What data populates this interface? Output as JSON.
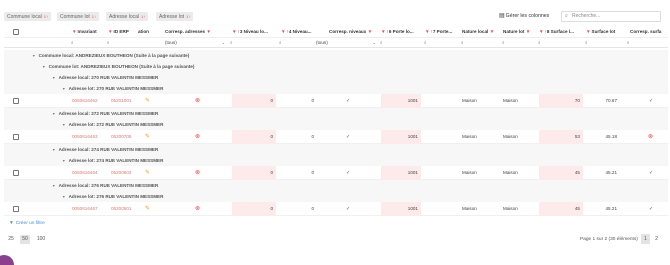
{
  "toolbar": {
    "chips": [
      {
        "label": "Commune local",
        "sort": "1↑"
      },
      {
        "label": "Commune lot",
        "sort": "1↑"
      },
      {
        "label": "Adresse local",
        "sort": "1↑"
      },
      {
        "label": "Adresse lot",
        "sort": "1↑"
      }
    ],
    "manage_columns": "Gérer les colonnes",
    "search_placeholder": "Recherche..."
  },
  "columns": [
    {
      "key": "invariant",
      "label": "Invariant"
    },
    {
      "key": "id_erp",
      "label": "ID ERP"
    },
    {
      "key": "action",
      "label": "ation"
    },
    {
      "key": "corresp_adresses",
      "label": "Corresp. adresses"
    },
    {
      "key": "niveau_lo",
      "label": "↑3 Niveau lo..."
    },
    {
      "key": "niveau",
      "label": "↑4 Niveau..."
    },
    {
      "key": "corresp_niveaux",
      "label": "Corresp. niveaux"
    },
    {
      "key": "porte_lo",
      "label": "↑6 Porte lo..."
    },
    {
      "key": "porte",
      "label": "↑7 Porte..."
    },
    {
      "key": "nature_local",
      "label": "Nature local"
    },
    {
      "key": "nature_lot",
      "label": "Nature lot"
    },
    {
      "key": "surface_l",
      "label": "↑8 Surface l..."
    },
    {
      "key": "surface_lot",
      "label": "Surface lot"
    },
    {
      "key": "corresp_surf",
      "label": "Corresp. surfa"
    }
  ],
  "filters": {
    "corresp_adresses": "(tous)",
    "corresp_niveaux": "(tous)"
  },
  "groups": {
    "commune_local": "Commune local: ANDREZIEUX BOUTHEON (Suite à la page suivante)",
    "commune_lot": "Commune lot: ANDREZIEUX BOUTHEON (Suite à la page suivante)"
  },
  "records": [
    {
      "adresse_local": "Adresse local: 270 RUE VALENTIN MESSMER",
      "adresse_lot": "Adresse lot: 270 RUE VALENTIN MESSMER",
      "invariant": "0050616462",
      "id_erp": "05201001",
      "niveau_lo": "0",
      "niveau": "0",
      "porte_lo": "1001",
      "nature_local": "Maison",
      "nature_lot": "Maison",
      "surface_l": "70",
      "surface_lot": "70.67",
      "surf_match": "ok"
    },
    {
      "adresse_local": "Adresse local: 272 RUE VALENTIN MESSMER",
      "adresse_lot": "Adresse lot: 272 RUE VALENTIN MESSMER",
      "invariant": "0050616463",
      "id_erp": "05200705",
      "niveau_lo": "0",
      "niveau": "0",
      "porte_lo": "1001",
      "nature_local": "Maison",
      "nature_lot": "Maison",
      "surface_l": "53",
      "surface_lot": "45.18",
      "surf_match": "ko"
    },
    {
      "adresse_local": "Adresse local: 274 RUE VALENTIN MESSMER",
      "adresse_lot": "Adresse lot: 274 RUE VALENTIN MESSMER",
      "invariant": "0050616464",
      "id_erp": "05200603",
      "niveau_lo": "0",
      "niveau": "0",
      "porte_lo": "1001",
      "nature_local": "Maison",
      "nature_lot": "Maison",
      "surface_l": "45",
      "surface_lot": "45.21",
      "surf_match": "ok"
    },
    {
      "adresse_local": "Adresse local: 276 RUE VALENTIN MESSMER",
      "adresse_lot": "Adresse lot: 276 RUE VALENTIN MESSMER",
      "invariant": "0050616467",
      "id_erp": "05200501",
      "niveau_lo": "0",
      "niveau": "0",
      "porte_lo": "1001",
      "nature_local": "Maison",
      "nature_lot": "Maison",
      "surface_l": "45",
      "surface_lot": "45.21",
      "surf_match": "ok"
    }
  ],
  "add_filter": "Créer un filtre",
  "pager": {
    "sizes": [
      "25",
      "50",
      "100"
    ],
    "active_size": "50",
    "info": "Page 1 sur 2 (30 éléments)",
    "pages": [
      "1",
      "2"
    ],
    "active_page": "1"
  },
  "colors": {
    "sort_red": "#e84a4a",
    "link": "#d97a74",
    "pink_cell": "#fdeaea",
    "accent_blue": "#4a8fcf",
    "avatar": "#8a3f8f"
  }
}
